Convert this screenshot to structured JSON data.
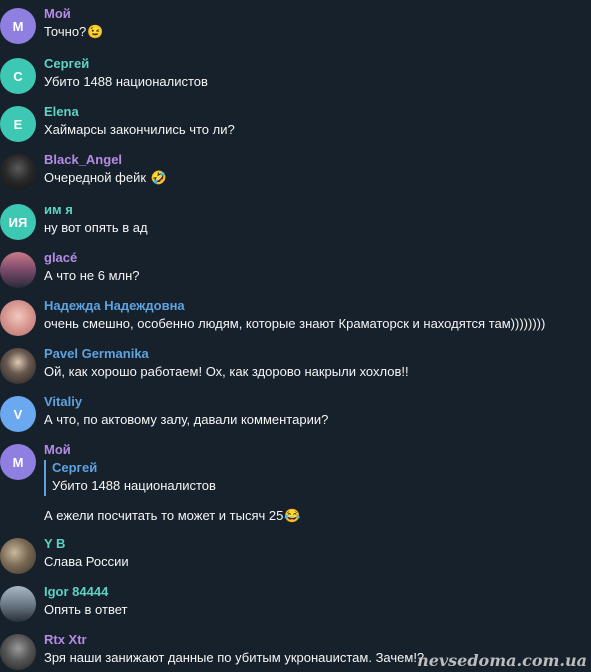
{
  "chat": {
    "messages": [
      {
        "initials": "М",
        "author": "Мой",
        "author_color": "#b48ce6",
        "avatar_color": "#8f7fe0",
        "text": "Точно?",
        "emoji": "😉"
      },
      {
        "initials": "С",
        "author": "Сергей",
        "author_color": "#5cd3c3",
        "avatar_color": "#3dc8b4",
        "text": "Убито 1488 националистов"
      },
      {
        "initials": "E",
        "author": "Elena",
        "author_color": "#5cd3c3",
        "avatar_color": "#3dc8b4",
        "text": "Хаймарсы закончились что ли?"
      },
      {
        "initials": "",
        "author": "Black_Angel",
        "author_color": "#b48ce6",
        "avatar_color": "#2a2a2a",
        "text": "Очередной фейк",
        "emoji": "🤣",
        "avatar_icon": "photo-avatar-icon"
      },
      {
        "initials": "ИЯ",
        "author": "им я",
        "author_color": "#5cd3c3",
        "avatar_color": "#3dc8b4",
        "text": "ну вот опять в ад"
      },
      {
        "initials": "",
        "author": "glacé",
        "author_color": "#b48ce6",
        "avatar_color": "#8a5a7c",
        "text": "А что не 6 млн?",
        "avatar_icon": "photo-avatar-icon"
      },
      {
        "initials": "",
        "author": "Надежда Надеждовна",
        "author_color": "#5ea2e0",
        "avatar_color": "#d8a9a0",
        "text": "очень смешно, особенно людям, которые знают Краматорск и находятся там))))))))",
        "avatar_icon": "photo-avatar-icon"
      },
      {
        "initials": "",
        "author": "Pavel Germanika",
        "author_color": "#5ea2e0",
        "avatar_color": "#3a3a3a",
        "text": "Ой, как хорошо работаем! Ох, как здорово накрыли хохлов!!",
        "avatar_icon": "photo-avatar-icon"
      },
      {
        "initials": "V",
        "author": "Vitaliy",
        "author_color": "#5ea2e0",
        "avatar_color": "#6ba8f0",
        "text": "А что, по актовому залу, давали комментарии?"
      },
      {
        "initials": "М",
        "author": "Мой",
        "author_color": "#b48ce6",
        "avatar_color": "#8f7fe0",
        "reply_author": "Сергей",
        "reply_text": "Убито 1488 националистов",
        "text": "А ежели посчитать то может и тысяч 25",
        "emoji": "😂"
      },
      {
        "initials": "",
        "author": "Y B",
        "author_color": "#5cd3c3",
        "avatar_color": "#7a6a55",
        "text": "Слава России",
        "avatar_icon": "photo-avatar-icon"
      },
      {
        "initials": "",
        "author": "Igor 84444",
        "author_color": "#5cd3c3",
        "avatar_color": "#6d7b88",
        "text": "Опять в ответ",
        "avatar_icon": "photo-avatar-icon"
      },
      {
        "initials": "",
        "author": "Rtx Xtr",
        "author_color": "#b48ce6",
        "avatar_color": "#555",
        "text": "Зря наши занижают данные по убитым укронаuистам. Зачем!?",
        "avatar_icon": "photo-avatar-icon"
      }
    ]
  },
  "watermark": "nevsedoma.com.ua"
}
